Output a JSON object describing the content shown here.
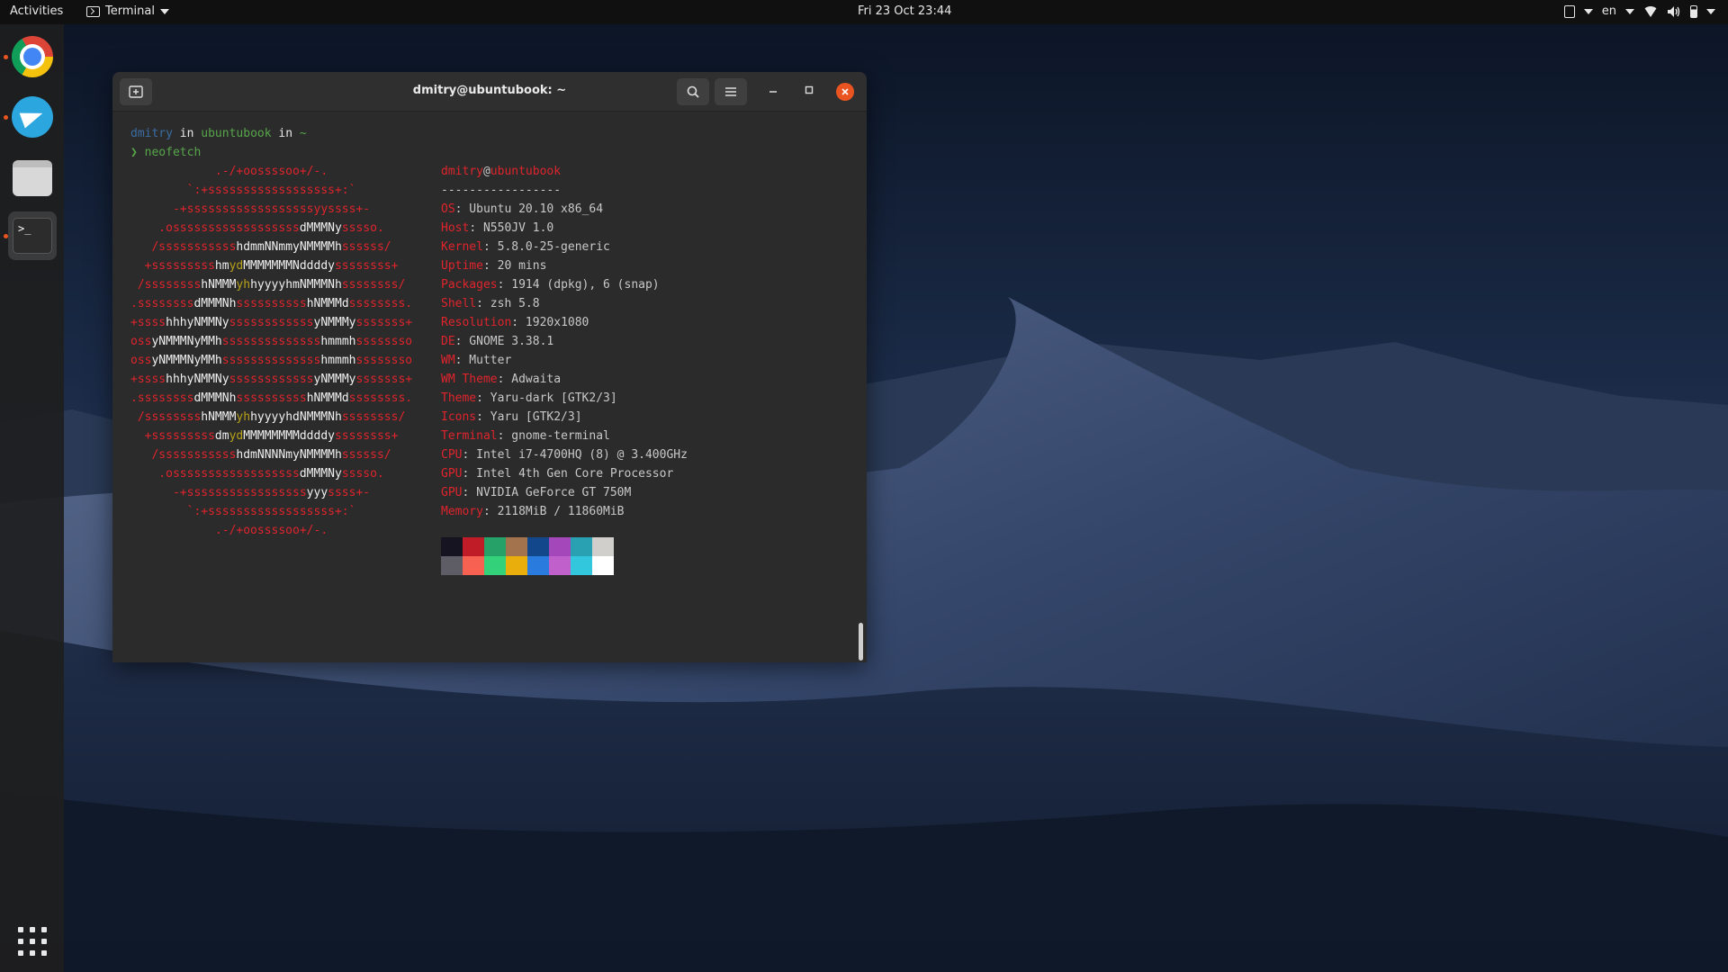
{
  "topbar": {
    "activities": "Activities",
    "app_name": "Terminal",
    "clock": "Fri 23 Oct  23:44",
    "lang": "en"
  },
  "dock": {
    "items": [
      "chrome-icon",
      "telegram-icon",
      "files-icon",
      "terminal-icon"
    ],
    "show_apps": "apps-grid-icon"
  },
  "terminal": {
    "title": "dmitry@ubuntubook: ~",
    "prompt_user": "dmitry",
    "prompt_in1": " in ",
    "prompt_host": "ubuntubook",
    "prompt_in2": " in ",
    "prompt_dir": "~",
    "prompt_arrow": "❯ ",
    "command": "neofetch",
    "user_host_user": "dmitry",
    "user_host_at": "@",
    "user_host_host": "ubuntubook",
    "separator": "-----------------",
    "info": [
      {
        "key": "OS",
        "value": ": Ubuntu 20.10 x86_64"
      },
      {
        "key": "Host",
        "value": ": N550JV 1.0"
      },
      {
        "key": "Kernel",
        "value": ": 5.8.0-25-generic"
      },
      {
        "key": "Uptime",
        "value": ": 20 mins"
      },
      {
        "key": "Packages",
        "value": ": 1914 (dpkg), 6 (snap)"
      },
      {
        "key": "Shell",
        "value": ": zsh 5.8"
      },
      {
        "key": "Resolution",
        "value": ": 1920x1080"
      },
      {
        "key": "DE",
        "value": ": GNOME 3.38.1"
      },
      {
        "key": "WM",
        "value": ": Mutter"
      },
      {
        "key": "WM Theme",
        "value": ": Adwaita"
      },
      {
        "key": "Theme",
        "value": ": Yaru-dark [GTK2/3]"
      },
      {
        "key": "Icons",
        "value": ": Yaru [GTK2/3]"
      },
      {
        "key": "Terminal",
        "value": ": gnome-terminal"
      },
      {
        "key": "CPU",
        "value": ": Intel i7-4700HQ (8) @ 3.400GHz"
      },
      {
        "key": "GPU",
        "value": ": Intel 4th Gen Core Processor"
      },
      {
        "key": "GPU",
        "value": ": NVIDIA GeForce GT 750M"
      },
      {
        "key": "Memory",
        "value": ": 2118MiB / 11860MiB"
      }
    ],
    "ascii_art": [
      [
        [
          "r",
          "            .-/+oossssoo+/-."
        ]
      ],
      [
        [
          "r",
          "        `:+ssssssssssssssssss+:`"
        ]
      ],
      [
        [
          "r",
          "      -+ssssssssssssssssssyyssss+-"
        ]
      ],
      [
        [
          "r",
          "    .ossssssssssssssssss"
        ],
        [
          "w",
          "dMMMNy"
        ],
        [
          "r",
          "sssso."
        ]
      ],
      [
        [
          "r",
          "   /sssssssssss"
        ],
        [
          "w",
          "hdmmNNmmyNMMMMh"
        ],
        [
          "r",
          "ssssss/"
        ]
      ],
      [
        [
          "r",
          "  +sssssssss"
        ],
        [
          "w",
          "hm"
        ],
        [
          "y",
          "yd"
        ],
        [
          "w",
          "MMMMMMMNddddy"
        ],
        [
          "r",
          "ssssssss+"
        ]
      ],
      [
        [
          "r",
          " /ssssssss"
        ],
        [
          "w",
          "hNMMM"
        ],
        [
          "y",
          "yh"
        ],
        [
          "w",
          "hyyyyhmNMMMNh"
        ],
        [
          "r",
          "ssssssss/"
        ]
      ],
      [
        [
          "r",
          ".ssssssss"
        ],
        [
          "w",
          "dMMMNh"
        ],
        [
          "r",
          "ssssssssss"
        ],
        [
          "w",
          "hNMMMd"
        ],
        [
          "r",
          "ssssssss."
        ]
      ],
      [
        [
          "r",
          "+ssss"
        ],
        [
          "w",
          "hhhyNMMNy"
        ],
        [
          "r",
          "ssssssssssss"
        ],
        [
          "w",
          "yNMMMy"
        ],
        [
          "r",
          "sssssss+"
        ]
      ],
      [
        [
          "r",
          "oss"
        ],
        [
          "w",
          "yNMMMNyMMh"
        ],
        [
          "r",
          "ssssssssssssss"
        ],
        [
          "w",
          "hmmmh"
        ],
        [
          "r",
          "ssssssso"
        ]
      ],
      [
        [
          "r",
          "oss"
        ],
        [
          "w",
          "yNMMMNyMMh"
        ],
        [
          "r",
          "ssssssssssssss"
        ],
        [
          "w",
          "hmmmh"
        ],
        [
          "r",
          "ssssssso"
        ]
      ],
      [
        [
          "r",
          "+ssss"
        ],
        [
          "w",
          "hhhyNMMNy"
        ],
        [
          "r",
          "ssssssssssss"
        ],
        [
          "w",
          "yNMMMy"
        ],
        [
          "r",
          "sssssss+"
        ]
      ],
      [
        [
          "r",
          ".ssssssss"
        ],
        [
          "w",
          "dMMMNh"
        ],
        [
          "r",
          "ssssssssss"
        ],
        [
          "w",
          "hNMMMd"
        ],
        [
          "r",
          "ssssssss."
        ]
      ],
      [
        [
          "r",
          " /ssssssss"
        ],
        [
          "w",
          "hNMMM"
        ],
        [
          "y",
          "yh"
        ],
        [
          "w",
          "hyyyyhdNMMMNh"
        ],
        [
          "r",
          "ssssssss/"
        ]
      ],
      [
        [
          "r",
          "  +sssssssss"
        ],
        [
          "w",
          "dm"
        ],
        [
          "y",
          "yd"
        ],
        [
          "w",
          "MMMMMMMMddddy"
        ],
        [
          "r",
          "ssssssss+"
        ]
      ],
      [
        [
          "r",
          "   /sssssssssss"
        ],
        [
          "w",
          "hdmNNNNmyNMMMMh"
        ],
        [
          "r",
          "ssssss/"
        ]
      ],
      [
        [
          "r",
          "    .ossssssssssssssssss"
        ],
        [
          "w",
          "dMMMNy"
        ],
        [
          "r",
          "sssso."
        ]
      ],
      [
        [
          "r",
          "      -+sssssssssssssssss"
        ],
        [
          "w",
          "yyy"
        ],
        [
          "r",
          "ssss+-"
        ]
      ],
      [
        [
          "r",
          "        `:+ssssssssssssssssss+:`"
        ]
      ],
      [
        [
          "r",
          "            .-/+oossssoo+/-."
        ]
      ]
    ],
    "palette": [
      "#171421",
      "#c01c28",
      "#26a269",
      "#a2734c",
      "#12488b",
      "#a347ba",
      "#2aa1b3",
      "#d0cfcc",
      "#5e5c64",
      "#f66151",
      "#33d17a",
      "#e9ad0c",
      "#2a7bde",
      "#c061cb",
      "#33c7de",
      "#ffffff"
    ]
  },
  "colors": {
    "accent": "#e95420",
    "ascii_red": "#e0242c",
    "prompt_blue": "#3b6ea5",
    "prompt_green": "#57a64a"
  }
}
